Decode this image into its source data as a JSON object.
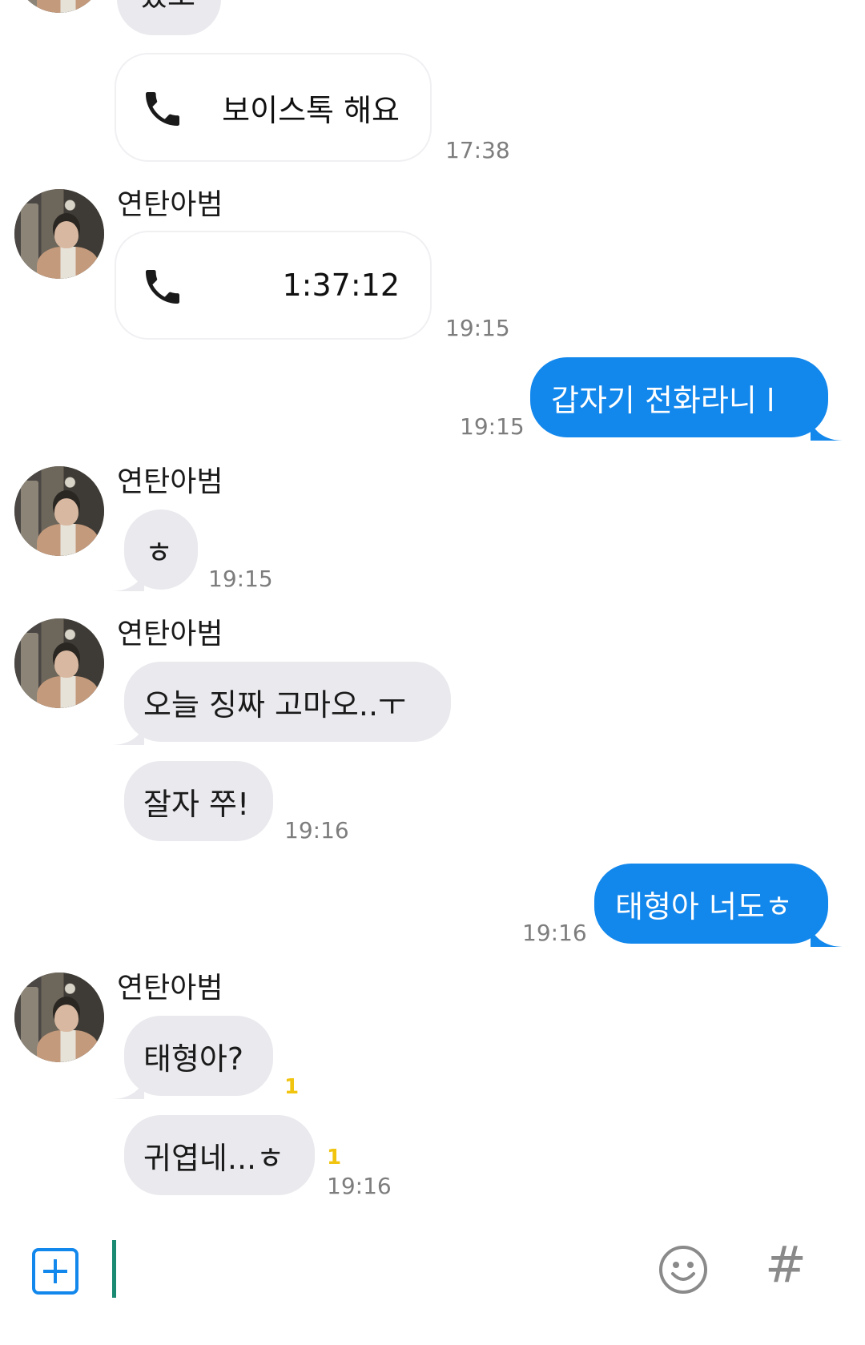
{
  "messages": {
    "top_partial": {
      "text": "줬오"
    },
    "call1": {
      "label": "보이스톡 해요",
      "time": "17:38"
    },
    "group1": {
      "sender": "연탄아범",
      "call_duration": "1:37:12",
      "time": "19:15"
    },
    "out1": {
      "text": "갑자기 전화라니 l",
      "time": "19:15"
    },
    "group2": {
      "sender": "연탄아범",
      "text": "ㅎ",
      "time": "19:15"
    },
    "group3": {
      "sender": "연탄아범",
      "text1": "오늘 징짜 고마오..ㅜ",
      "text2": "잘자 쭈!",
      "time": "19:16"
    },
    "out2": {
      "text": "태형아 너도ㅎ",
      "time": "19:16"
    },
    "group4": {
      "sender": "연탄아범",
      "text1": "태형아?",
      "unread1": "1",
      "text2": "귀엽네...ㅎ",
      "unread2": "1",
      "time": "19:16"
    }
  },
  "input_bar": {
    "icons": [
      "plus-icon",
      "emoji-icon",
      "hash-icon"
    ],
    "hash_glyph": "#"
  },
  "colors": {
    "outgoing_bubble": "#1287ec",
    "incoming_bubble": "#e9e9ee",
    "unread": "#f1c40f",
    "cursor": "#1a8a72"
  }
}
